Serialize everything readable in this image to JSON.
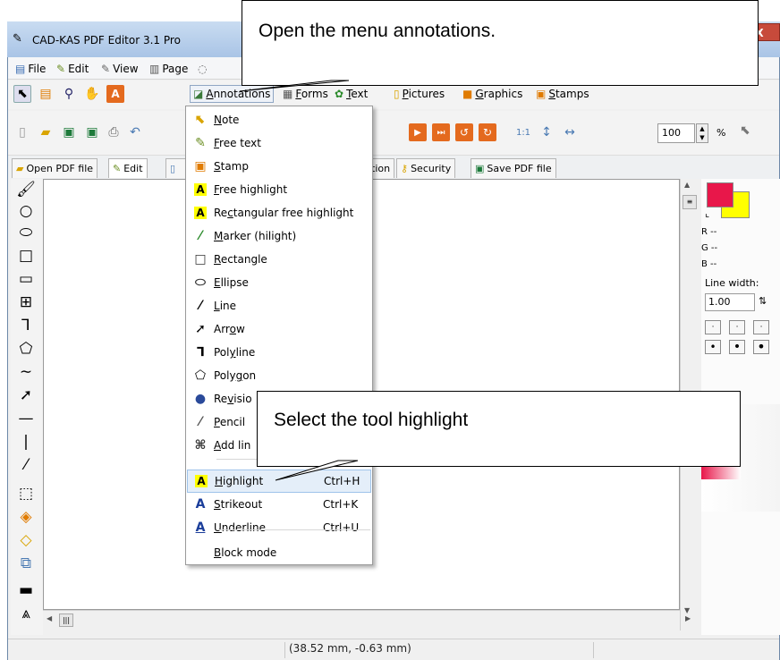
{
  "window": {
    "title": "CAD-KAS PDF Editor 3.1 Pro",
    "close_glyph": "X"
  },
  "menubar": [
    {
      "label": "File",
      "icon": "file-icon"
    },
    {
      "label": "Edit",
      "icon": "edit-icon"
    },
    {
      "label": "View",
      "icon": "view-icon"
    },
    {
      "label": "Page",
      "icon": "page-icon"
    }
  ],
  "toolbar_tabs": [
    {
      "label": "Annotations",
      "underline": "A",
      "rest": "nnotations",
      "icon": "annotations-icon"
    },
    {
      "label": "Forms",
      "underline": "F",
      "rest": "orms",
      "icon": "forms-icon"
    },
    {
      "label": "Text",
      "underline": "T",
      "rest": "ext",
      "icon": "text-icon"
    },
    {
      "label": "Pictures",
      "underline": "P",
      "rest": "ictures",
      "icon": "pictures-icon"
    },
    {
      "label": "Graphics",
      "underline": "G",
      "rest": "raphics",
      "icon": "graphics-icon"
    },
    {
      "label": "Stamps",
      "underline": "S",
      "rest": "tamps",
      "icon": "stamps-icon"
    }
  ],
  "zoom": {
    "value": "100",
    "unit": "%"
  },
  "mode_tabs": [
    {
      "label": "Open PDF file",
      "icon": "open-pdf-icon"
    },
    {
      "label": "Edit",
      "icon": "edit-tab-icon"
    },
    {
      "label": "tion",
      "icon": ""
    },
    {
      "label": "Security",
      "icon": "key-icon"
    },
    {
      "label": "Save PDF file",
      "icon": "save-pdf-icon"
    }
  ],
  "dropdown": {
    "items": [
      {
        "pre": "",
        "u": "N",
        "post": "ote",
        "icon": "note-icon",
        "shortcut": ""
      },
      {
        "pre": "",
        "u": "F",
        "post": "ree text",
        "icon": "free-text-icon",
        "shortcut": ""
      },
      {
        "pre": "",
        "u": "S",
        "post": "tamp",
        "icon": "stamp-icon",
        "shortcut": ""
      },
      {
        "pre": "",
        "u": "F",
        "post": "ree highlight",
        "icon": "free-highlight-icon",
        "shortcut": ""
      },
      {
        "pre": "Re",
        "u": "c",
        "post": "tangular free highlight",
        "icon": "rect-free-highlight-icon",
        "shortcut": ""
      },
      {
        "pre": "",
        "u": "M",
        "post": "arker (hilight)",
        "icon": "marker-icon",
        "shortcut": ""
      },
      {
        "pre": "",
        "u": "R",
        "post": "ectangle",
        "icon": "rectangle-icon",
        "shortcut": ""
      },
      {
        "pre": "",
        "u": "E",
        "post": "llipse",
        "icon": "ellipse-icon",
        "shortcut": ""
      },
      {
        "pre": "",
        "u": "L",
        "post": "ine",
        "icon": "line-icon",
        "shortcut": ""
      },
      {
        "pre": "Arr",
        "u": "o",
        "post": "w",
        "icon": "arrow-icon",
        "shortcut": ""
      },
      {
        "pre": "Pol",
        "u": "y",
        "post": "line",
        "icon": "polyline-icon",
        "shortcut": ""
      },
      {
        "pre": "Poly",
        "u": "g",
        "post": "on",
        "icon": "polygon-icon",
        "shortcut": ""
      },
      {
        "pre": "Re",
        "u": "v",
        "post": "isio",
        "icon": "revision-icon",
        "shortcut": ""
      },
      {
        "pre": "",
        "u": "P",
        "post": "encil",
        "icon": "pencil-icon",
        "shortcut": ""
      },
      {
        "pre": "",
        "u": "A",
        "post": "dd lin",
        "icon": "add-link-icon",
        "shortcut": ""
      },
      {
        "pre": "",
        "u": "H",
        "post": "ighlight",
        "icon": "highlight-icon",
        "shortcut": "Ctrl+H"
      },
      {
        "pre": "",
        "u": "S",
        "post": "trikeout",
        "icon": "strikeout-icon",
        "shortcut": "Ctrl+K"
      },
      {
        "pre": "",
        "u": "U",
        "post": "nderline",
        "icon": "underline-icon",
        "shortcut": "Ctrl+U"
      },
      {
        "pre": "",
        "u": "B",
        "post": "lock mode",
        "icon": "",
        "shortcut": ""
      }
    ]
  },
  "right_panel": {
    "r": "R --",
    "g": "G --",
    "b": "B --",
    "line_width_label": "Line width:",
    "line_width_value": "1.00",
    "primary_color": "#e8174a",
    "secondary_color": "#ffff00"
  },
  "status": {
    "coords": "(38.52 mm, -0.63 mm)"
  },
  "callouts": {
    "top": "Open the menu annotations.",
    "bottom": "Select the tool highlight"
  }
}
